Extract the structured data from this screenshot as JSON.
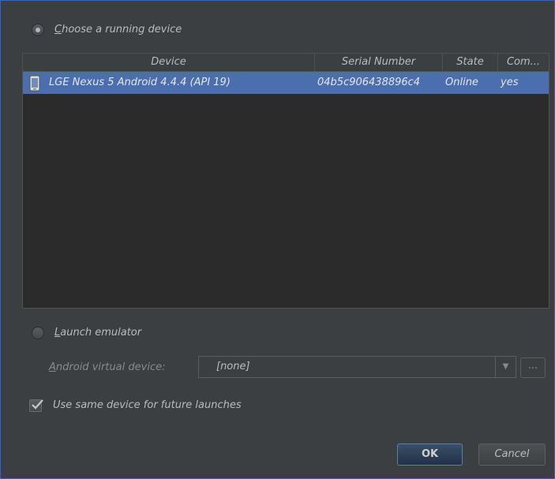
{
  "options": {
    "choose_running": {
      "mnemonic": "C",
      "rest": "hoose a running device",
      "selected": true
    },
    "launch_emulator": {
      "mnemonic": "L",
      "rest": "aunch emulator",
      "selected": false
    }
  },
  "device_table": {
    "columns": [
      "Device",
      "Serial Number",
      "State",
      "Com..."
    ],
    "rows": [
      {
        "icon": "phone-icon",
        "device": "LGE Nexus 5 Android 4.4.4 (API 19)",
        "serial": "04b5c906438896c4",
        "state": "Online",
        "compatible": "yes",
        "selected": true
      }
    ]
  },
  "avd": {
    "label_mnemonic": "A",
    "label_rest": "ndroid virtual device:",
    "value": "[none]",
    "browse_label": "..."
  },
  "use_same_device": {
    "label": "Use same device for future launches",
    "checked": true
  },
  "buttons": {
    "ok": "OK",
    "cancel": "Cancel"
  },
  "colors": {
    "background": "#3c3f41",
    "selection": "#4b6eaf",
    "border_accent": "#2f65ca"
  }
}
